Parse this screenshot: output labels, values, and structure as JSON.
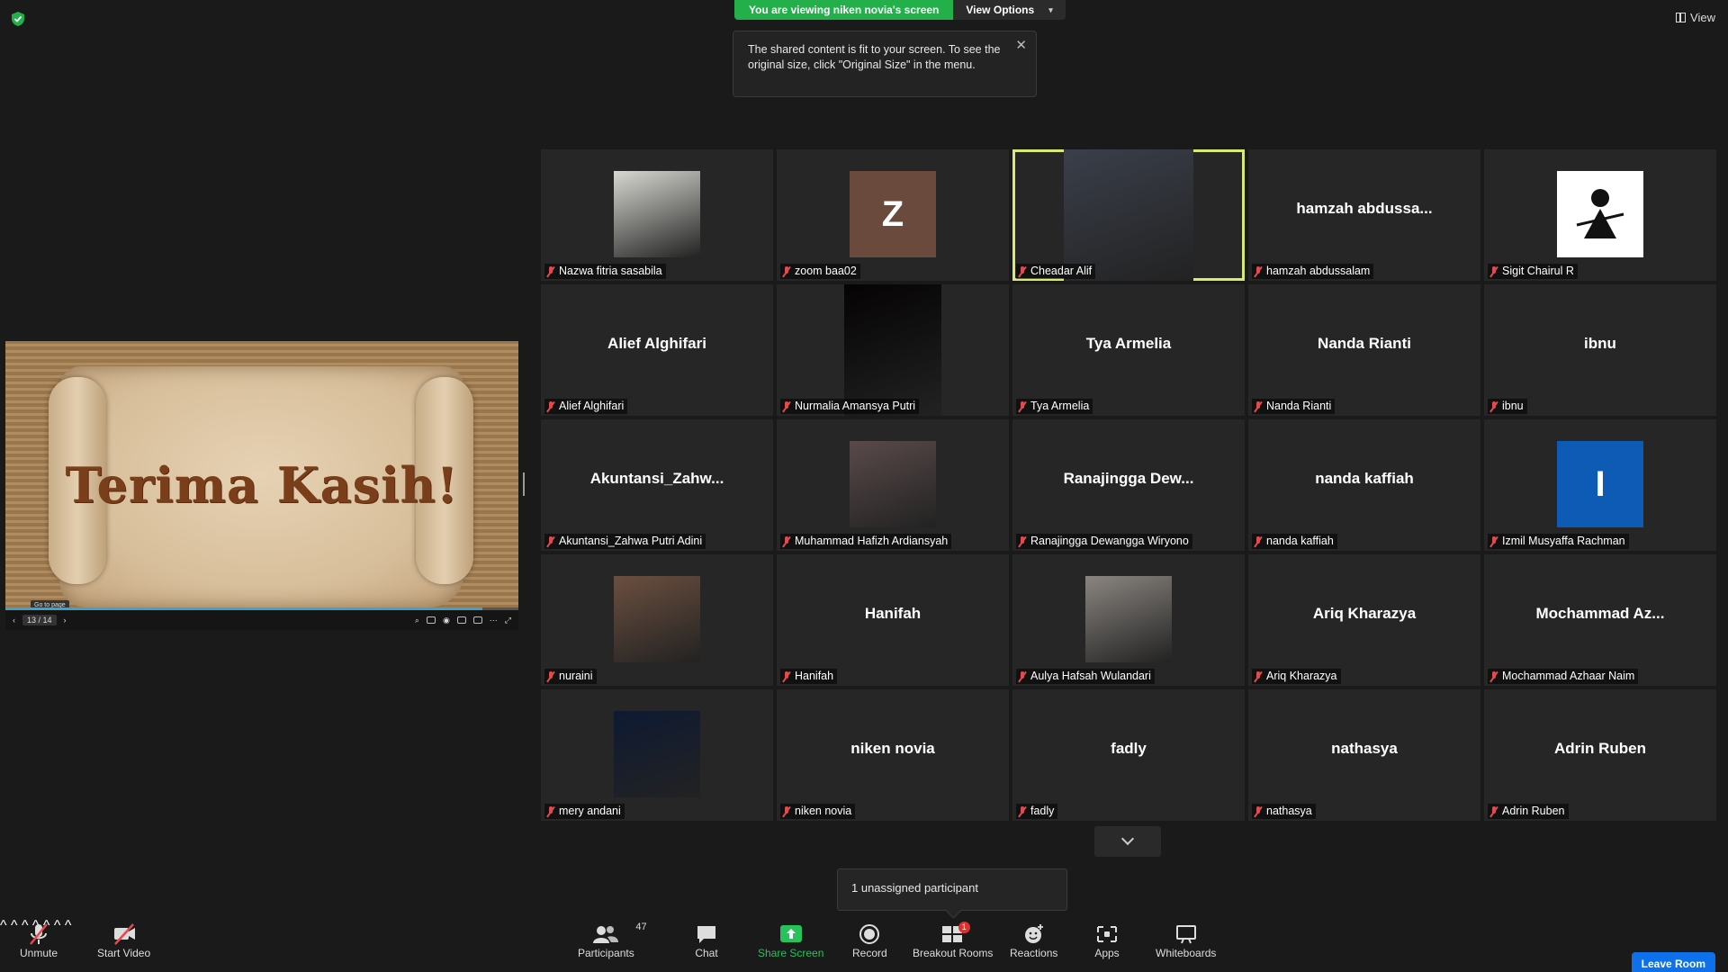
{
  "banner": {
    "viewing": "You are viewing niken novia's screen",
    "view_options": "View Options"
  },
  "view_button": "View",
  "tooltip": "The shared content is fit to your screen. To see the original size, click \"Original Size\" in the menu.",
  "shared_content": {
    "slide_title": "Terima Kasih!",
    "page": "13 / 14",
    "go_to_page": "Go to page",
    "progress": 0.93
  },
  "participants": [
    {
      "name": "Nazwa fitria sasabila",
      "video": "photo",
      "bg": "#d8d8d2"
    },
    {
      "name": "zoom baa02",
      "avatar_letter": "Z",
      "bg": "#6b4a3e"
    },
    {
      "name": "Cheadar Alif",
      "video": "photo",
      "bg": "#3a3f4a",
      "active": true
    },
    {
      "name": "hamzah abdussalam",
      "display": "hamzah  abdussa..."
    },
    {
      "name": "Sigit Chairul R",
      "video": "logo",
      "bg": "#ffffff"
    },
    {
      "name": "Alief Alghifari",
      "display": "Alief Alghifari"
    },
    {
      "name": "Nurmalia Amansya Putri",
      "video": "dark",
      "bg": "#050304"
    },
    {
      "name": "Tya Armelia",
      "display": "Tya Armelia"
    },
    {
      "name": "Nanda Rianti",
      "display": "Nanda Rianti"
    },
    {
      "name": "ibnu",
      "display": "ibnu"
    },
    {
      "name": "Akuntansi_Zahwa Putri Adini",
      "display": "Akuntansi_Zahw..."
    },
    {
      "name": "Muhammad Hafizh Ardiansyah",
      "video": "photo",
      "bg": "#5a4a4a"
    },
    {
      "name": "Ranajingga Dewangga Wiryono",
      "display": "Ranajingga  Dew..."
    },
    {
      "name": "nanda kaffiah",
      "display": "nanda kaffiah"
    },
    {
      "name": "Izmil Musyaffa Rachman",
      "avatar_letter": "I",
      "bg": "#0d5bb5"
    },
    {
      "name": "nuraini",
      "video": "photo",
      "bg": "#6b4f3f"
    },
    {
      "name": "Hanifah",
      "display": "Hanifah"
    },
    {
      "name": "Aulya Hafsah Wulandari",
      "video": "photo",
      "bg": "#8a8580"
    },
    {
      "name": "Ariq Kharazya",
      "display": "Ariq Kharazya"
    },
    {
      "name": "Mochammad Azhaar Naim",
      "display": "Mochammad  Az..."
    },
    {
      "name": "mery andani",
      "video": "photo",
      "bg": "#0e1a33"
    },
    {
      "name": "niken novia",
      "display": "niken novia"
    },
    {
      "name": "fadly",
      "display": "fadly"
    },
    {
      "name": "nathasya",
      "display": "nathasya"
    },
    {
      "name": "Adrin Ruben",
      "display": "Adrin Ruben"
    }
  ],
  "unassigned": "1 unassigned participant",
  "toolbar": {
    "unmute": "Unmute",
    "start_video": "Start Video",
    "participants": "Participants",
    "participants_count": "47",
    "chat": "Chat",
    "share_screen": "Share Screen",
    "record": "Record",
    "breakout_rooms": "Breakout Rooms",
    "breakout_badge": "1",
    "reactions": "Reactions",
    "apps": "Apps",
    "whiteboards": "Whiteboards",
    "leave_room": "Leave Room"
  },
  "colors": {
    "accent_green": "#23b04a",
    "active_speaker": "#d7ea76",
    "leave_blue": "#0e71eb",
    "mute_red": "#e5484d"
  }
}
